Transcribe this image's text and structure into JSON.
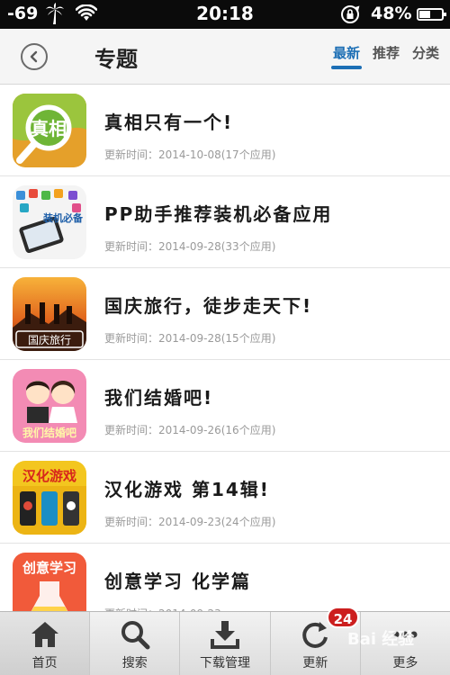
{
  "status_bar": {
    "signal": "-69",
    "time": "20:18",
    "battery_text": "48%",
    "battery_level": 0.48
  },
  "header": {
    "title": "专题",
    "tabs": [
      {
        "label": "最新",
        "active": true
      },
      {
        "label": "推荐",
        "active": false
      },
      {
        "label": "分类",
        "active": false
      }
    ]
  },
  "topics": [
    {
      "title": "真相只有一个!",
      "meta": "更新时间：2014-10-08(17个应用)",
      "thumb_text": "真相"
    },
    {
      "title": "PP助手推荐装机必备应用",
      "meta": "更新时间：2014-09-28(33个应用)",
      "thumb_text": "装机必备"
    },
    {
      "title": "国庆旅行，徒步走天下!",
      "meta": "更新时间：2014-09-28(15个应用)",
      "thumb_text": "国庆旅行"
    },
    {
      "title": "我们结婚吧!",
      "meta": "更新时间：2014-09-26(16个应用)",
      "thumb_text": "我们结婚吧"
    },
    {
      "title": "汉化游戏 第14辑!",
      "meta": "更新时间：2014-09-23(24个应用)",
      "thumb_text": "汉化游戏"
    },
    {
      "title": "创意学习 化学篇",
      "meta": "更新时间：2014-09-23",
      "thumb_text": "创意学习"
    }
  ],
  "tabbar": {
    "items": [
      {
        "label": "首页",
        "icon": "home-icon",
        "active": true
      },
      {
        "label": "搜索",
        "icon": "search-icon",
        "active": false
      },
      {
        "label": "下载管理",
        "icon": "download-icon",
        "active": false
      },
      {
        "label": "更新",
        "icon": "refresh-icon",
        "active": false,
        "badge": "24"
      },
      {
        "label": "更多",
        "icon": "more-icon",
        "active": false
      }
    ]
  },
  "watermark": "Bai 经验",
  "colors": {
    "accent": "#1d6fb5",
    "badge": "#cc1e1e"
  }
}
